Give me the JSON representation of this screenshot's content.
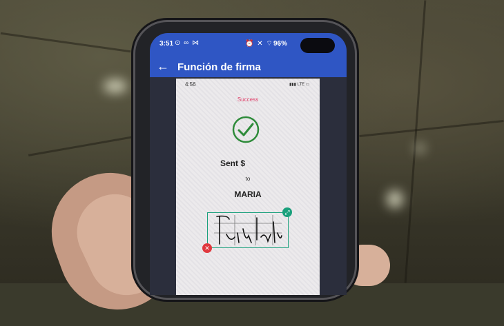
{
  "status_bar": {
    "time": "3:51",
    "left_icons": "⊙ ∞ ⋈",
    "right_icons": "⏰ ✕ ⌔ ⋮",
    "battery": "96%"
  },
  "app_bar": {
    "back_icon": "arrow-left-icon",
    "title": "Función de firma"
  },
  "inner_screen": {
    "time": "4:56",
    "status_icons": "▮▮▮ LTE ▭",
    "header": "Success",
    "sent_label": "Sent $",
    "to_label": "to",
    "recipient": "MARIA"
  },
  "signature": {
    "resize_icon": "resize-icon",
    "delete_icon": "close-icon"
  },
  "colors": {
    "app_bar": "#2f56c4",
    "success_text": "#e0406a",
    "check_green": "#2e8b3a",
    "signature_frame": "#1aa07c",
    "delete_red": "#e0383e"
  }
}
